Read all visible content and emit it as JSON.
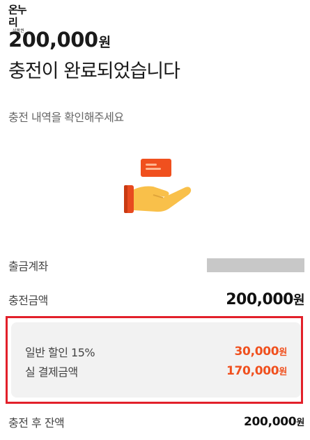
{
  "brand": {
    "logo_text": "온누리",
    "logo_sub": "상품권"
  },
  "header": {
    "amount": "200,000",
    "amount_unit": "원",
    "title": "충전이 완료되었습니다",
    "subtitle": "충전 내역을 확인해주세요"
  },
  "illustration": {
    "icon": "hand-receiving-card-icon",
    "colors": {
      "card": "#f0501e",
      "hand": "#f9c04a",
      "sleeve": "#e84a1f"
    }
  },
  "details": {
    "withdraw_account_label": "출금계좌",
    "charge_amount_label": "충전금액",
    "charge_amount": "200,000",
    "charge_amount_unit": "원",
    "discount_label": "일반 할인 15%",
    "discount_amount": "30,000",
    "discount_unit": "원",
    "actual_payment_label": "실 결제금액",
    "actual_payment": "170,000",
    "actual_payment_unit": "원",
    "balance_label": "충전 후 잔액",
    "balance": "200,000",
    "balance_unit": "원"
  },
  "colors": {
    "accent": "#f0501e",
    "highlight_border": "#e2202a",
    "box_background": "#f2f2f2"
  }
}
